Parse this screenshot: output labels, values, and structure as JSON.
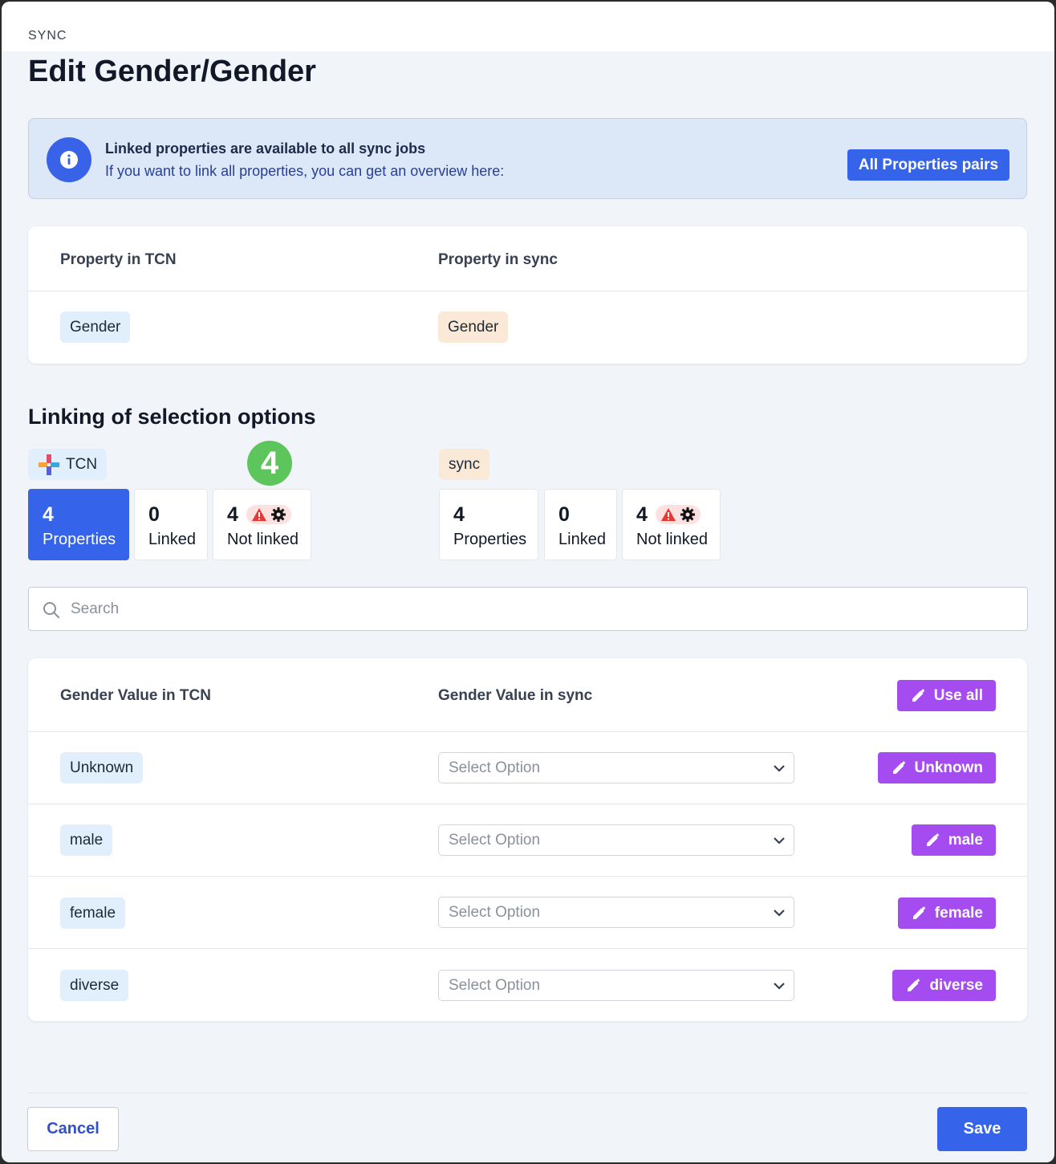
{
  "header": {
    "eyebrow": "SYNC",
    "title": "Edit Gender/Gender"
  },
  "info_banner": {
    "title": "Linked properties are available to all sync jobs",
    "text": "If you want to link all properties, you can get an overview here:",
    "button_label": "All Properties pairs",
    "icon": "info-icon"
  },
  "property_table": {
    "col_tcn": "Property in TCN",
    "col_sync": "Property in sync",
    "tcn_value": "Gender",
    "sync_value": "Gender"
  },
  "linking": {
    "title": "Linking of selection options",
    "badge": "4",
    "tcn": {
      "label": "TCN",
      "stats": [
        {
          "num": "4",
          "label": "Properties"
        },
        {
          "num": "0",
          "label": "Linked"
        },
        {
          "num": "4",
          "label": "Not linked"
        }
      ]
    },
    "sync": {
      "label": "sync",
      "stats": [
        {
          "num": "4",
          "label": "Properties"
        },
        {
          "num": "0",
          "label": "Linked"
        },
        {
          "num": "4",
          "label": "Not linked"
        }
      ]
    }
  },
  "search": {
    "placeholder": "Search"
  },
  "values_table": {
    "col_tcn": "Gender Value in TCN",
    "col_sync": "Gender Value in sync",
    "use_all_label": "Use all",
    "rows": [
      {
        "tcn": "Unknown",
        "select": "Select Option",
        "action": "Unknown"
      },
      {
        "tcn": "male",
        "select": "Select Option",
        "action": "male"
      },
      {
        "tcn": "female",
        "select": "Select Option",
        "action": "female"
      },
      {
        "tcn": "diverse",
        "select": "Select Option",
        "action": "diverse"
      }
    ]
  },
  "footer": {
    "cancel_label": "Cancel",
    "save_label": "Save"
  },
  "colors": {
    "primary": "#3563e9",
    "purple": "#a54cf0",
    "badge_green": "#5cc65c",
    "warning_red": "#e53935"
  }
}
